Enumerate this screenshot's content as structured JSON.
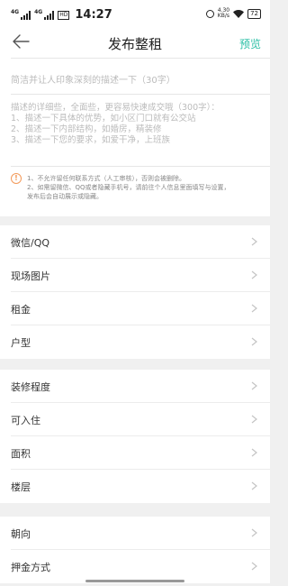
{
  "status": {
    "network": "4G",
    "network2": "4G",
    "sim_badge": "HD",
    "time": "14:27",
    "speed_value": "4.30",
    "speed_unit": "KB/s",
    "battery": "72"
  },
  "header": {
    "title": "发布整租",
    "preview_label": "预览"
  },
  "editor": {
    "summary_placeholder": "简洁并让人印象深刻的描述一下（30字）",
    "detail_placeholder_lines": [
      "描述的详细些，全面些，更容易快速成交哦（300字）：",
      "1、描述一下具体的优势，如小区门口就有公交站",
      "2、描述一下内部结构，如婚房，精装修",
      "3、描述一下您的要求，如爱干净，上班族"
    ],
    "tip_lines": [
      "1、不允许留任何联系方式（人工审核），否则会被删除。",
      "2、如需留微信、QQ或者隐藏手机号，请前往个人信息里面填写与设置，",
      "发布后会自动展示或隐藏。"
    ]
  },
  "sections": [
    {
      "items": [
        {
          "label": "微信/QQ"
        },
        {
          "label": "现场图片"
        },
        {
          "label": "租金"
        },
        {
          "label": "户型"
        }
      ]
    },
    {
      "items": [
        {
          "label": "装修程度"
        },
        {
          "label": "可入住"
        },
        {
          "label": "面积"
        },
        {
          "label": "楼层"
        }
      ]
    },
    {
      "items": [
        {
          "label": "朝向"
        },
        {
          "label": "押金方式"
        }
      ]
    }
  ],
  "colors": {
    "accent": "#2bbfa6",
    "warning": "#f39a5a"
  }
}
